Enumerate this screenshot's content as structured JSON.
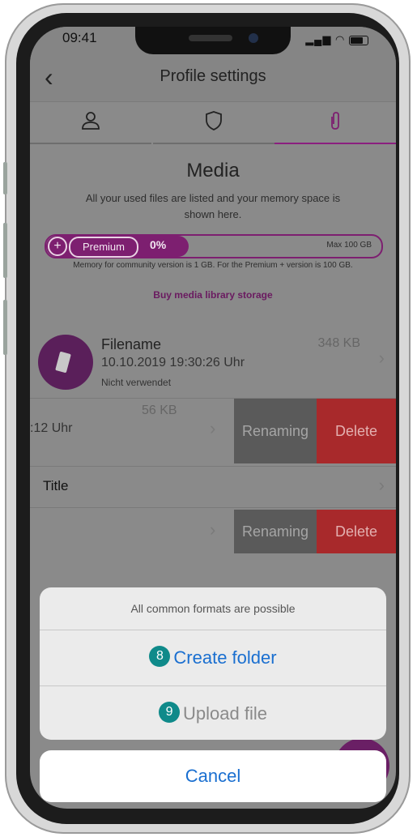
{
  "status_bar": {
    "time": "09:41"
  },
  "nav": {
    "back_label": "‹",
    "title": "Profile settings"
  },
  "tabs": [
    {
      "icon": "user-icon"
    },
    {
      "icon": "shield-icon"
    },
    {
      "icon": "paperclip-icon",
      "active": true
    }
  ],
  "media": {
    "title": "Media",
    "description": "All your used files are listed and your memory space is shown here.",
    "storage": {
      "plus": "+",
      "premium_label": "Premium",
      "percent": "0%",
      "max": "Max 100 GB",
      "used_fraction": 0
    },
    "memory_note": "Memory for community version is 1 GB. For the Premium + version is 100 GB.",
    "buy_link": "Buy media library storage"
  },
  "files": [
    {
      "name": "Filename",
      "date": "10.10.2019 19:30:26 Uhr",
      "status": "Nicht verwendet",
      "size": "348 KB"
    },
    {
      "date_partial": ":12 Uhr",
      "size": "56 KB"
    }
  ],
  "swipe_actions": {
    "rename": "Renaming",
    "delete": "Delete"
  },
  "title_row": {
    "label": "Title"
  },
  "action_sheet": {
    "message": "All common formats are possible",
    "create_badge": "8",
    "create_label": "Create folder",
    "upload_badge": "9",
    "upload_label": "Upload file",
    "cancel_label": "Cancel"
  },
  "colors": {
    "accent": "#7d1f70",
    "link": "#1a6fd0",
    "delete": "#a8292b",
    "badge": "#0f8a8a"
  }
}
